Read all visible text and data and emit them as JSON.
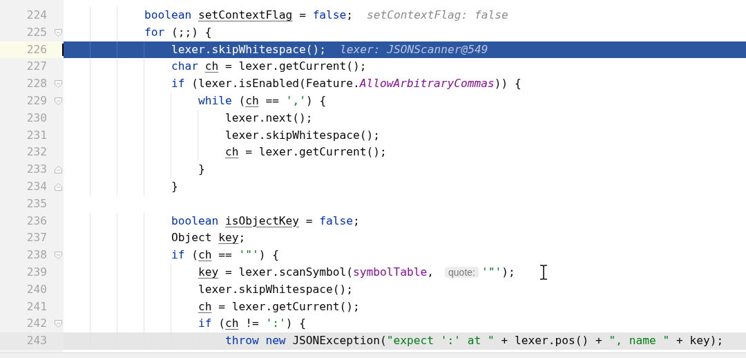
{
  "editor": {
    "lines": [
      {
        "number": "224",
        "current": false,
        "shaded": false,
        "tokens": [
          {
            "kind": "keyword",
            "text": "            boolean "
          },
          {
            "kind": "var",
            "text": "setContextFlag"
          },
          {
            "kind": "plain",
            "text": " = "
          },
          {
            "kind": "keyword",
            "text": "false"
          },
          {
            "kind": "plain",
            "text": ";"
          },
          {
            "kind": "hint",
            "text": "setContextFlag: false"
          }
        ]
      },
      {
        "number": "225",
        "fold_start": true,
        "current": false,
        "shaded": false,
        "tokens": [
          {
            "kind": "keyword",
            "text": "            for"
          },
          {
            "kind": "plain",
            "text": " (;;) {"
          }
        ]
      },
      {
        "number": "226",
        "current": true,
        "shaded": false,
        "tokens": [
          {
            "kind": "plain",
            "text": "                lexer.skipWhitespace();"
          },
          {
            "kind": "hint",
            "text": "lexer: JSONScanner@549"
          }
        ]
      },
      {
        "number": "227",
        "current": false,
        "shaded": false,
        "tokens": [
          {
            "kind": "keyword",
            "text": "                char "
          },
          {
            "kind": "var",
            "text": "ch"
          },
          {
            "kind": "plain",
            "text": " = lexer.getCurrent();"
          }
        ]
      },
      {
        "number": "228",
        "fold_start": true,
        "current": false,
        "shaded": false,
        "tokens": [
          {
            "kind": "keyword",
            "text": "                if"
          },
          {
            "kind": "plain",
            "text": " (lexer.isEnabled(Feature."
          },
          {
            "kind": "static",
            "text": "AllowArbitraryCommas"
          },
          {
            "kind": "plain",
            "text": ")) {"
          }
        ]
      },
      {
        "number": "229",
        "fold_start": true,
        "current": false,
        "shaded": false,
        "tokens": [
          {
            "kind": "keyword",
            "text": "                    while"
          },
          {
            "kind": "plain",
            "text": " ("
          },
          {
            "kind": "var",
            "text": "ch"
          },
          {
            "kind": "plain",
            "text": " == "
          },
          {
            "kind": "string",
            "text": "','"
          },
          {
            "kind": "plain",
            "text": ") {"
          }
        ]
      },
      {
        "number": "230",
        "current": false,
        "shaded": false,
        "tokens": [
          {
            "kind": "plain",
            "text": "                        lexer.next();"
          }
        ]
      },
      {
        "number": "231",
        "current": false,
        "shaded": false,
        "tokens": [
          {
            "kind": "plain",
            "text": "                        lexer.skipWhitespace();"
          }
        ]
      },
      {
        "number": "232",
        "current": false,
        "shaded": false,
        "tokens": [
          {
            "kind": "var",
            "text": "                        ch"
          },
          {
            "kind": "plain",
            "text": " = lexer.getCurrent();"
          }
        ]
      },
      {
        "number": "233",
        "fold_end": true,
        "current": false,
        "shaded": false,
        "tokens": [
          {
            "kind": "plain",
            "text": "                    }"
          }
        ]
      },
      {
        "number": "234",
        "fold_end": true,
        "current": false,
        "shaded": false,
        "tokens": [
          {
            "kind": "plain",
            "text": "                }"
          }
        ]
      },
      {
        "number": "235",
        "current": false,
        "shaded": false
      },
      {
        "number": "236",
        "current": false,
        "shaded": false,
        "tokens": [
          {
            "kind": "keyword",
            "text": "                boolean "
          },
          {
            "kind": "var",
            "text": "isObjectKey"
          },
          {
            "kind": "plain",
            "text": " = "
          },
          {
            "kind": "keyword",
            "text": "false"
          },
          {
            "kind": "plain",
            "text": ";"
          }
        ]
      },
      {
        "number": "237",
        "current": false,
        "shaded": false,
        "tokens": [
          {
            "kind": "plain",
            "text": "                Object "
          },
          {
            "kind": "var",
            "text": "key"
          },
          {
            "kind": "plain",
            "text": ";"
          }
        ]
      },
      {
        "number": "238",
        "fold_start": true,
        "current": false,
        "shaded": false,
        "tokens": [
          {
            "kind": "keyword",
            "text": "                if"
          },
          {
            "kind": "plain",
            "text": " ("
          },
          {
            "kind": "var",
            "text": "ch"
          },
          {
            "kind": "plain",
            "text": " == "
          },
          {
            "kind": "string",
            "text": "'\"'"
          },
          {
            "kind": "plain",
            "text": ") {"
          }
        ]
      },
      {
        "number": "239",
        "current": false,
        "shaded": false,
        "tokens": [
          {
            "kind": "var",
            "text": "                    key"
          },
          {
            "kind": "plain",
            "text": " = lexer.scanSymbol("
          },
          {
            "kind": "field",
            "text": "symbolTable"
          },
          {
            "kind": "plain",
            "text": ","
          },
          {
            "kind": "param",
            "text": "quote:"
          },
          {
            "kind": "string",
            "text": "'\"'"
          },
          {
            "kind": "plain",
            "text": ");"
          }
        ]
      },
      {
        "number": "240",
        "current": false,
        "shaded": false,
        "tokens": [
          {
            "kind": "plain",
            "text": "                    lexer.skipWhitespace();"
          }
        ]
      },
      {
        "number": "241",
        "current": false,
        "shaded": false,
        "tokens": [
          {
            "kind": "var",
            "text": "                    ch"
          },
          {
            "kind": "plain",
            "text": " = lexer.getCurrent();"
          }
        ]
      },
      {
        "number": "242",
        "fold_start": true,
        "current": false,
        "shaded": false,
        "tokens": [
          {
            "kind": "keyword",
            "text": "                    if"
          },
          {
            "kind": "plain",
            "text": " ("
          },
          {
            "kind": "var",
            "text": "ch"
          },
          {
            "kind": "plain",
            "text": " != "
          },
          {
            "kind": "string",
            "text": "':'"
          },
          {
            "kind": "plain",
            "text": ") {"
          }
        ]
      },
      {
        "number": "243",
        "current": false,
        "shaded": true,
        "tokens": [
          {
            "kind": "keyword",
            "text": "                        throw new"
          },
          {
            "kind": "plain",
            "text": " JSONException("
          },
          {
            "kind": "string",
            "text": "\"expect ':' at \""
          },
          {
            "kind": "plain",
            "text": " + lexer.pos() + "
          },
          {
            "kind": "string",
            "text": "\", name \""
          },
          {
            "kind": "plain",
            "text": " + key);"
          }
        ]
      }
    ]
  }
}
